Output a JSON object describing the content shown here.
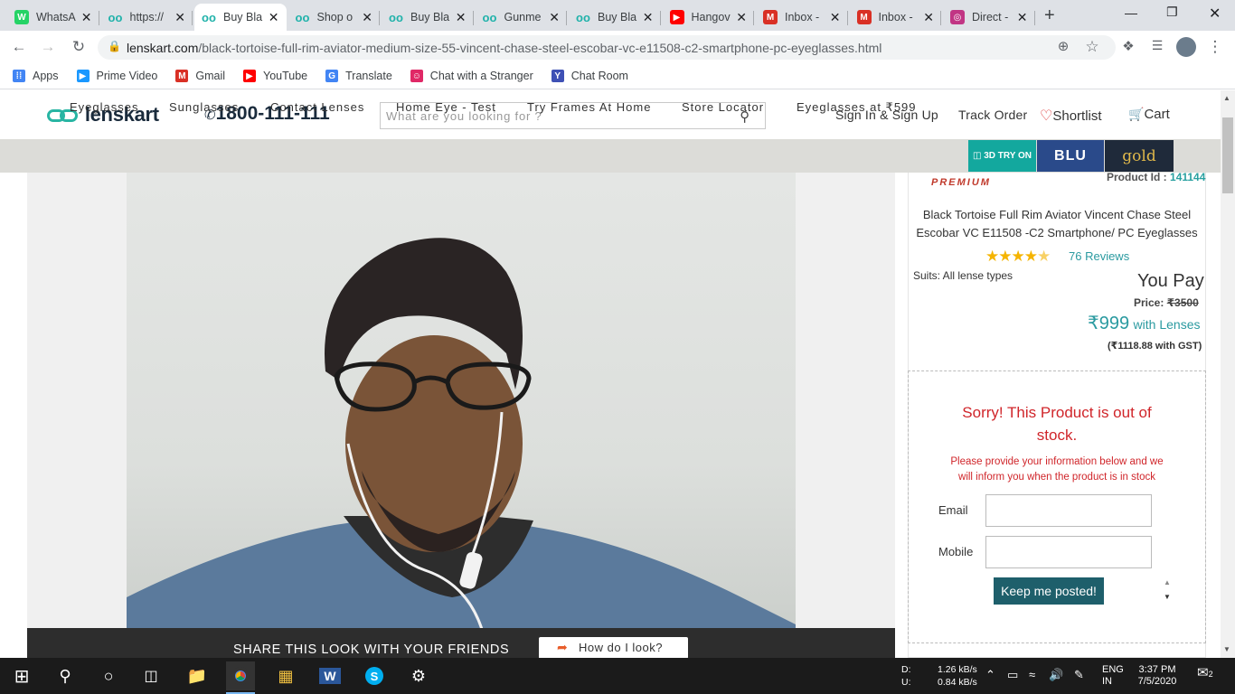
{
  "browser": {
    "tabs": [
      {
        "title": "WhatsA",
        "icon": "whatsapp-icon",
        "color": "#25d366"
      },
      {
        "title": "https://",
        "icon": "lenskart-icon",
        "color": "#20b2aa"
      },
      {
        "title": "Buy Bla",
        "icon": "lenskart-icon",
        "color": "#20b2aa",
        "active": true
      },
      {
        "title": "Shop o",
        "icon": "lenskart-icon",
        "color": "#20b2aa"
      },
      {
        "title": "Buy Bla",
        "icon": "lenskart-icon",
        "color": "#20b2aa"
      },
      {
        "title": "Gunme",
        "icon": "lenskart-icon",
        "color": "#20b2aa"
      },
      {
        "title": "Buy Bla",
        "icon": "lenskart-icon",
        "color": "#20b2aa"
      },
      {
        "title": "Hangov",
        "icon": "youtube-icon",
        "color": "#ff0000"
      },
      {
        "title": "Inbox -",
        "icon": "gmail-icon",
        "color": "#d93025"
      },
      {
        "title": "Inbox -",
        "icon": "gmail-icon",
        "color": "#d93025"
      },
      {
        "title": "Direct -",
        "icon": "instagram-icon",
        "color": "#c13584"
      }
    ],
    "url_host": "lenskart.com",
    "url_path": "/black-tortoise-full-rim-aviator-medium-size-55-vincent-chase-steel-escobar-vc-e11508-c2-smartphone-pc-eyeglasses.html",
    "bookmarks": [
      {
        "label": "Apps",
        "icon": "apps-grid-icon"
      },
      {
        "label": "Prime Video",
        "icon": "prime-video-icon"
      },
      {
        "label": "Gmail",
        "icon": "gmail-icon"
      },
      {
        "label": "YouTube",
        "icon": "youtube-icon"
      },
      {
        "label": "Translate",
        "icon": "translate-icon"
      },
      {
        "label": "Chat with a Stranger",
        "icon": "chat-icon"
      },
      {
        "label": "Chat Room",
        "icon": "chat-room-icon"
      }
    ]
  },
  "site": {
    "logo": "lenskart",
    "phone": "1800-111-111",
    "search_placeholder": "What are you looking for ?",
    "header_links": {
      "signin": "Sign In & Sign Up",
      "track": "Track Order",
      "shortlist": "Shortlist",
      "cart": "Cart"
    },
    "nav": [
      "Eyeglasses",
      "Sunglasses",
      "Contact Lenses",
      "Home Eye - Test",
      "Try Frames At Home",
      "Store Locator",
      "Eyeglasses at ₹599"
    ],
    "badges": {
      "tryon": "3D TRY ON",
      "blu": "BLU",
      "gold": "gold"
    }
  },
  "product": {
    "brand_tag": "PREMIUM",
    "id_label": "Product Id :",
    "id_value": "141144",
    "title_line1": "Black Tortoise Full Rim Aviator Vincent Chase Steel",
    "title_line2": "Escobar VC E11508 -C2 Smartphone/ PC Eyeglasses",
    "rating": 4.5,
    "reviews": "76 Reviews",
    "suits": "Suits: All lense types",
    "you_pay": "You Pay",
    "price_label": "Price:",
    "price_mrp": "₹3500",
    "price": "₹999",
    "with_lenses": "with Lenses",
    "gst": "(₹1118.88 with GST)",
    "oos_line1": "Sorry! This Product is out of",
    "oos_line2": "stock.",
    "oos_msg1": "Please provide your information below and we",
    "oos_msg2": "will inform you when the product is in stock",
    "email_label": "Email",
    "mobile_label": "Mobile",
    "keep_btn": "Keep me posted!"
  },
  "share": {
    "text": "SHARE THIS LOOK WITH YOUR FRIENDS",
    "button": "How do I look?"
  },
  "taskbar": {
    "net_d_label": "D:",
    "net_u_label": "U:",
    "net_d": "1.26 kB/s",
    "net_u": "0.84 kB/s",
    "lang1": "ENG",
    "lang2": "IN",
    "time": "3:37 PM",
    "date": "7/5/2020",
    "notif_count": "2"
  }
}
